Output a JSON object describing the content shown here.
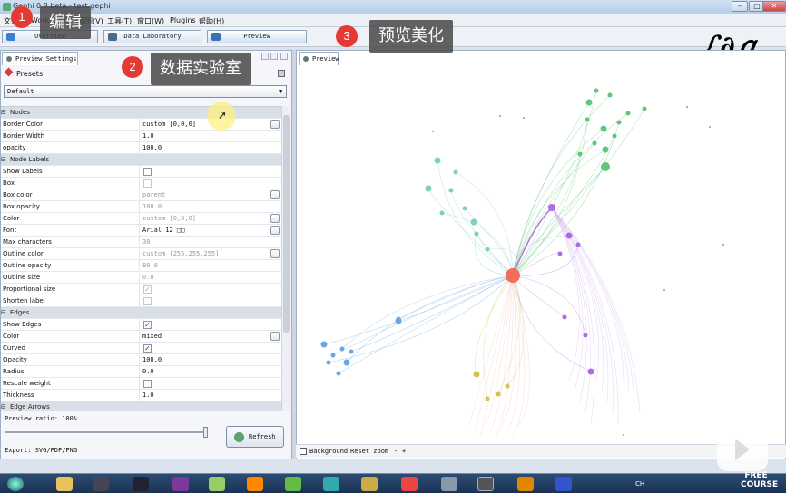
{
  "window": {
    "title": "Gephi 0.8 beta - test.gephi"
  },
  "menu": [
    "文件",
    "Workspace",
    "视图(V)",
    "工具(T)",
    "窗口(W)",
    "Plugins",
    "帮助(H)"
  ],
  "toolbar": {
    "overview": "Overview",
    "data_lab": "Data Laboratory",
    "preview": "Preview"
  },
  "callouts": [
    {
      "num": "1",
      "text": "编辑"
    },
    {
      "num": "2",
      "text": "数据实验室"
    },
    {
      "num": "3",
      "text": "预览美化"
    }
  ],
  "left_panel": {
    "tab": "Preview Settings",
    "presets_label": "Presets",
    "preset_selected": "Default",
    "rows": [
      {
        "type": "cat",
        "name": "Nodes"
      },
      {
        "type": "val",
        "name": "Border Color",
        "value": "custom [0,0,0]",
        "ellipsis": true
      },
      {
        "type": "val",
        "name": "Border Width",
        "value": "1.0"
      },
      {
        "type": "val",
        "name": "opacity",
        "value": "100.0"
      },
      {
        "type": "cat",
        "name": "Node Labels"
      },
      {
        "type": "chk",
        "name": "Show Labels",
        "checked": false
      },
      {
        "type": "chk",
        "name": "Box",
        "checked": false,
        "dim": true
      },
      {
        "type": "val",
        "name": "Box color",
        "value": "parent",
        "dim": true,
        "ellipsis": true
      },
      {
        "type": "val",
        "name": "Box opacity",
        "value": "100.0",
        "dim": true
      },
      {
        "type": "val",
        "name": "Color",
        "value": "custom [0,0,0]",
        "dim": true,
        "ellipsis": true
      },
      {
        "type": "val",
        "name": "Font",
        "value": "Arial 12 □□",
        "ellipsis": true
      },
      {
        "type": "val",
        "name": "Max characters",
        "value": "30",
        "dim": true
      },
      {
        "type": "val",
        "name": "Outline color",
        "value": "custom [255,255,255]",
        "dim": true,
        "ellipsis": true
      },
      {
        "type": "val",
        "name": "Outline opacity",
        "value": "80.0",
        "dim": true
      },
      {
        "type": "val",
        "name": "Outline size",
        "value": "0.0",
        "dim": true
      },
      {
        "type": "chk",
        "name": "Proportional size",
        "checked": true,
        "dim": true
      },
      {
        "type": "chk",
        "name": "Shorten label",
        "checked": false,
        "dim": true
      },
      {
        "type": "cat",
        "name": "Edges"
      },
      {
        "type": "chk",
        "name": "Show Edges",
        "checked": true
      },
      {
        "type": "val",
        "name": "Color",
        "value": "mixed",
        "ellipsis": true
      },
      {
        "type": "chk",
        "name": "Curved",
        "checked": true
      },
      {
        "type": "val",
        "name": "Opacity",
        "value": "100.0"
      },
      {
        "type": "val",
        "name": "Radius",
        "value": "0.0"
      },
      {
        "type": "chk",
        "name": "Rescale weight",
        "checked": false
      },
      {
        "type": "val",
        "name": "Thickness",
        "value": "1.0"
      },
      {
        "type": "cat",
        "name": "Edge Arrows"
      }
    ],
    "ratio": "Preview ratio: 100%",
    "refresh": "Refresh",
    "export": "Export:  SVG/PDF/PNG"
  },
  "right_panel": {
    "tab": "Preview",
    "bottom": {
      "background": "Background",
      "reset": "Reset zoom",
      "minus": "-",
      "plus": "+"
    }
  },
  "taskbar": {
    "lang": "CH"
  },
  "watermark": "FREE COURSE",
  "colors": {
    "badge": "#e53935",
    "callout_bg": "#484848",
    "hub": "#f26b5b",
    "green": "#5cc878",
    "teal": "#7ecfc0",
    "blue": "#6aa6e0",
    "purple": "#b06ae6"
  }
}
